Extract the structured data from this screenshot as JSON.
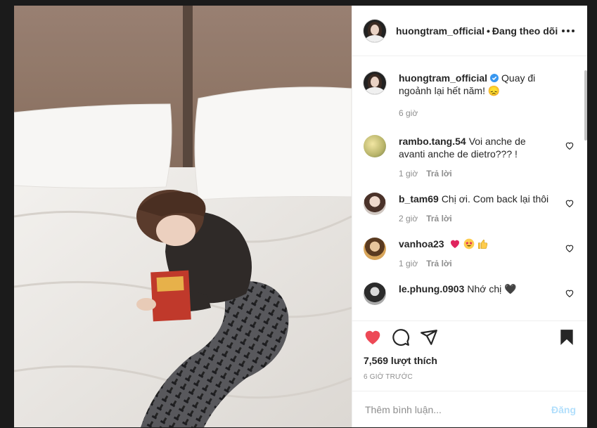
{
  "post": {
    "username": "huongtram_official",
    "separator": "•",
    "follow_status": "Đang theo dõi"
  },
  "caption": {
    "username": "huongtram_official",
    "verified": true,
    "text": "Quay đi ngoảnh lại hết năm! 😞",
    "time": "6 giờ"
  },
  "comments": [
    {
      "username": "rambo.tang.54",
      "text": "Voi anche de avanti anche de dietro??? !",
      "time": "1 giờ",
      "reply": "Trả lời"
    },
    {
      "username": "b_tam69",
      "text": "Chị ơi. Com back lại thôi",
      "time": "2 giờ",
      "reply": "Trả lời"
    },
    {
      "username": "vanhoa23",
      "text": "",
      "emojis": [
        "red-heart",
        "star-struck",
        "thumbs-up"
      ],
      "time": "1 giờ",
      "reply": "Trả lời"
    },
    {
      "username": "le.phung.0903",
      "text": "Nhớ chị 🖤",
      "time": "",
      "reply": ""
    }
  ],
  "actions": {
    "liked": true,
    "like_color": "#ed4956",
    "likes": "7,569 lượt thích",
    "timestamp": "6 GIỜ TRƯỚC"
  },
  "add_comment": {
    "placeholder": "Thêm bình luận...",
    "post_label": "Đăng"
  }
}
